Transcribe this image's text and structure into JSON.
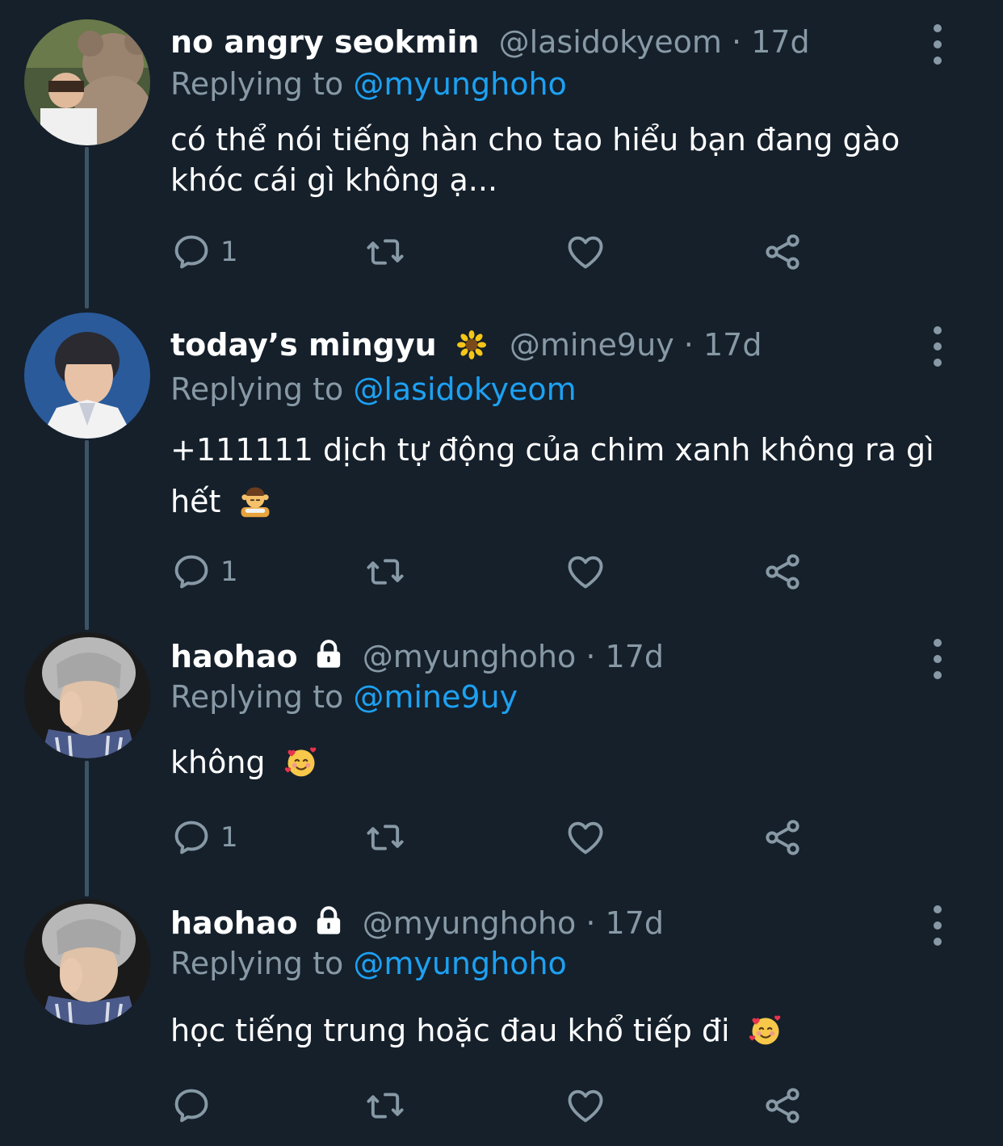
{
  "tweets": [
    {
      "name": "no angry seokmin",
      "handle": "@lasidokyeom",
      "separator": "·",
      "time": "17d",
      "replying_label": "Replying to",
      "replying_to": "@myunghoho",
      "text": "có thể nói tiếng hàn cho tao hiểu bạn đang gào khóc cái gì không ạ...",
      "reply_count": "1",
      "avatar": "teddy-bear-photo"
    },
    {
      "name": "today’s mingyu",
      "handle": "@mine9uy",
      "separator": "·",
      "time": "17d",
      "replying_label": "Replying to",
      "replying_to": "@lasidokyeom",
      "text": "+111111 dịch tự động của chim xanh không ra gì hết",
      "reply_count": "1",
      "avatar": "person-blue-sky-photo",
      "name_emoji": "sunflower-icon",
      "text_emoji": "face-massage-emoji"
    },
    {
      "name": "haohao",
      "handle": "@myunghoho",
      "separator": "·",
      "time": "17d",
      "replying_label": "Replying to",
      "replying_to": "@mine9uy",
      "text": "không",
      "reply_count": "1",
      "avatar": "silver-hair-person-photo",
      "text_emoji": "smiling-face-with-hearts-emoji"
    },
    {
      "name": "haohao",
      "handle": "@myunghoho",
      "separator": "·",
      "time": "17d",
      "replying_label": "Replying to",
      "replying_to": "@myunghoho",
      "text": "học tiếng trung hoặc đau khổ tiếp đi",
      "reply_count": "",
      "avatar": "silver-hair-person-photo",
      "text_emoji": "smiling-face-with-hearts-emoji"
    }
  ],
  "colors": {
    "background": "#15202b",
    "secondary_text": "#8899a6",
    "link": "#1da1f2",
    "thread_line": "#3d5466"
  }
}
